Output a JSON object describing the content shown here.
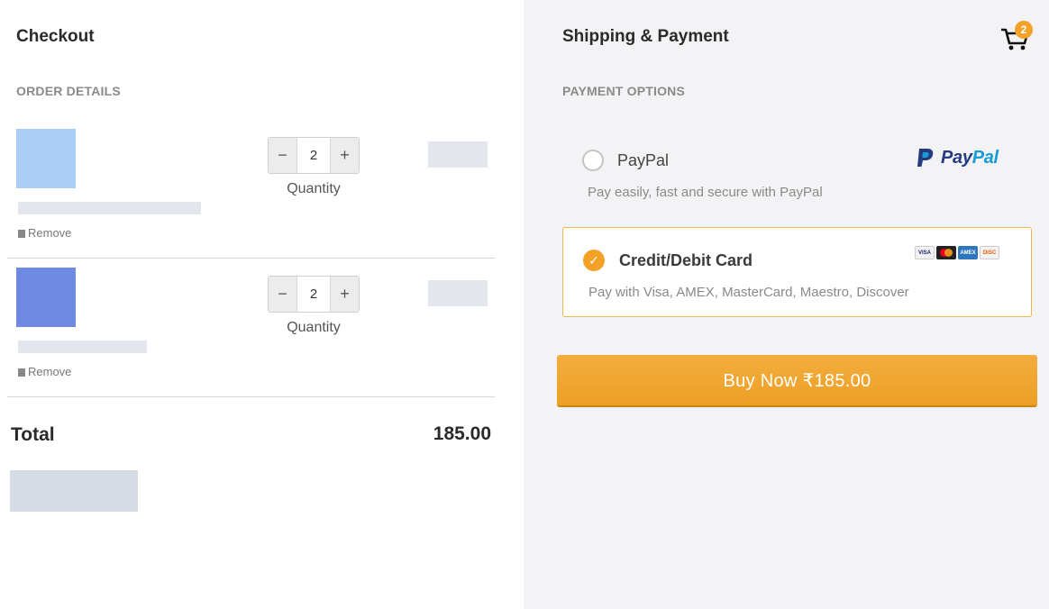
{
  "left": {
    "title": "Checkout",
    "section": "ORDER DETAILS",
    "items": [
      {
        "thumb_color": "#a9cdf5",
        "quantity": "2",
        "quantity_label": "Quantity",
        "remove_label": "Remove",
        "decrement": "−",
        "increment": "+"
      },
      {
        "thumb_color": "#6f8ae3",
        "quantity": "2",
        "quantity_label": "Quantity",
        "remove_label": "Remove",
        "decrement": "−",
        "increment": "+"
      }
    ],
    "total_label": "Total",
    "total_value": "185.00"
  },
  "right": {
    "title": "Shipping & Payment",
    "cart_count": "2",
    "section": "PAYMENT OPTIONS",
    "paypal": {
      "title": "PayPal",
      "description": "Pay easily, fast and secure with PayPal",
      "logo_pay": "Pay",
      "logo_pal": "Pal",
      "selected": false
    },
    "card": {
      "title": "Credit/Debit Card",
      "description": "Pay with Visa, AMEX, MasterCard, Maestro, Discover",
      "selected": true,
      "brands": [
        "VISA",
        "MC",
        "AMEX",
        "DISC"
      ]
    },
    "buy_button": "Buy Now ₹185.00"
  },
  "colors": {
    "accent": "#f4a127",
    "paypal_blue_dark": "#253b80",
    "paypal_blue_light": "#179bd7"
  }
}
